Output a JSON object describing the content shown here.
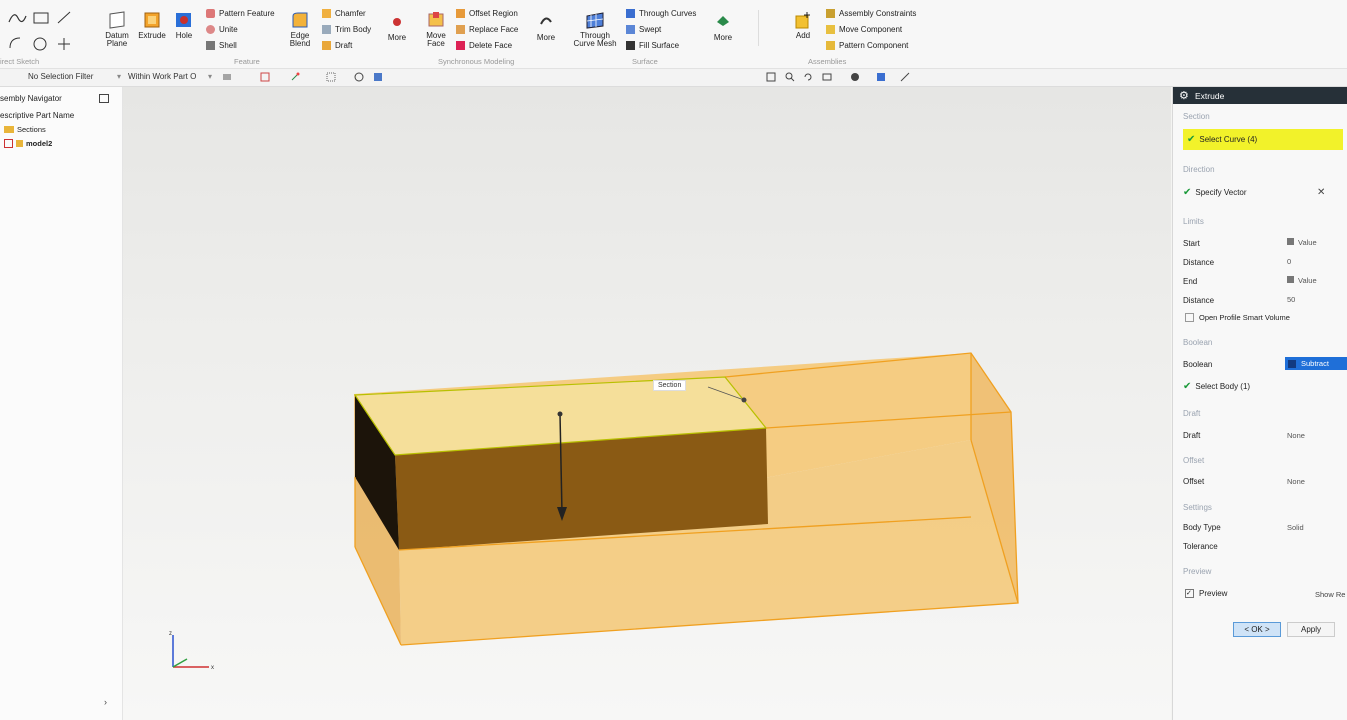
{
  "ribbon": {
    "direct_sketch_label": "irect Sketch",
    "feature_group_label": "Feature",
    "sync_group_label": "Synchronous Modeling",
    "surface_group_label": "Surface",
    "assemblies_group_label": "Assemblies",
    "datum_plane": "Datum Plane",
    "extrude": "Extrude",
    "hole": "Hole",
    "pattern_feature": "Pattern Feature",
    "unite": "Unite",
    "shell": "Shell",
    "edge_blend": "Edge Blend",
    "chamfer": "Chamfer",
    "trim_body": "Trim Body",
    "draft": "Draft",
    "more1": "More",
    "move_face": "Move Face",
    "offset_region": "Offset Region",
    "replace_face": "Replace Face",
    "delete_face": "Delete Face",
    "more2": "More",
    "through_curve_mesh": "Through Curve Mesh",
    "through_curves": "Through Curves",
    "swept": "Swept",
    "fill_surface": "Fill Surface",
    "more3": "More",
    "add": "Add",
    "assembly_constraints": "Assembly Constraints",
    "move_component": "Move Component",
    "pattern_component": "Pattern Component"
  },
  "toolbar": {
    "selection_filter": "No Selection Filter",
    "scope": "Within Work Part O"
  },
  "navigator": {
    "title": "sembly Navigator",
    "column": "escriptive Part Name",
    "sections": "Sections",
    "model": "model2"
  },
  "viewport": {
    "section_tag": "Section"
  },
  "dialog": {
    "title": "Extrude",
    "section_header": "Section",
    "select_curve": "Select Curve (4)",
    "direction_header": "Direction",
    "specify_vector": "Specify Vector",
    "limits_header": "Limits",
    "start_label": "Start",
    "start_value": "Value",
    "distance1_label": "Distance",
    "distance1_value": "0",
    "end_label": "End",
    "end_value": "Value",
    "distance2_label": "Distance",
    "distance2_value": "50",
    "open_profile": "Open Profile Smart Volume",
    "boolean_header": "Boolean",
    "boolean_label": "Boolean",
    "boolean_value": "Subtract",
    "select_body": "Select Body (1)",
    "draft_header": "Draft",
    "draft_label": "Draft",
    "draft_value": "None",
    "offset_header": "Offset",
    "offset_label": "Offset",
    "offset_value": "None",
    "settings_header": "Settings",
    "body_type_label": "Body Type",
    "body_type_value": "Solid",
    "tolerance_label": "Tolerance",
    "preview_header": "Preview",
    "preview_label": "Preview",
    "show_result": "Show Re",
    "ok_button": "< OK >",
    "apply_button": "Apply"
  },
  "colors": {
    "solid_fill": "#f5c26a",
    "solid_edge": "#f0a020",
    "tool_body": "#8a5a14",
    "highlight_yellow": "#f2f22a",
    "boolean_blue": "#1f6fd8",
    "dialog_title_bar": "#263038"
  }
}
